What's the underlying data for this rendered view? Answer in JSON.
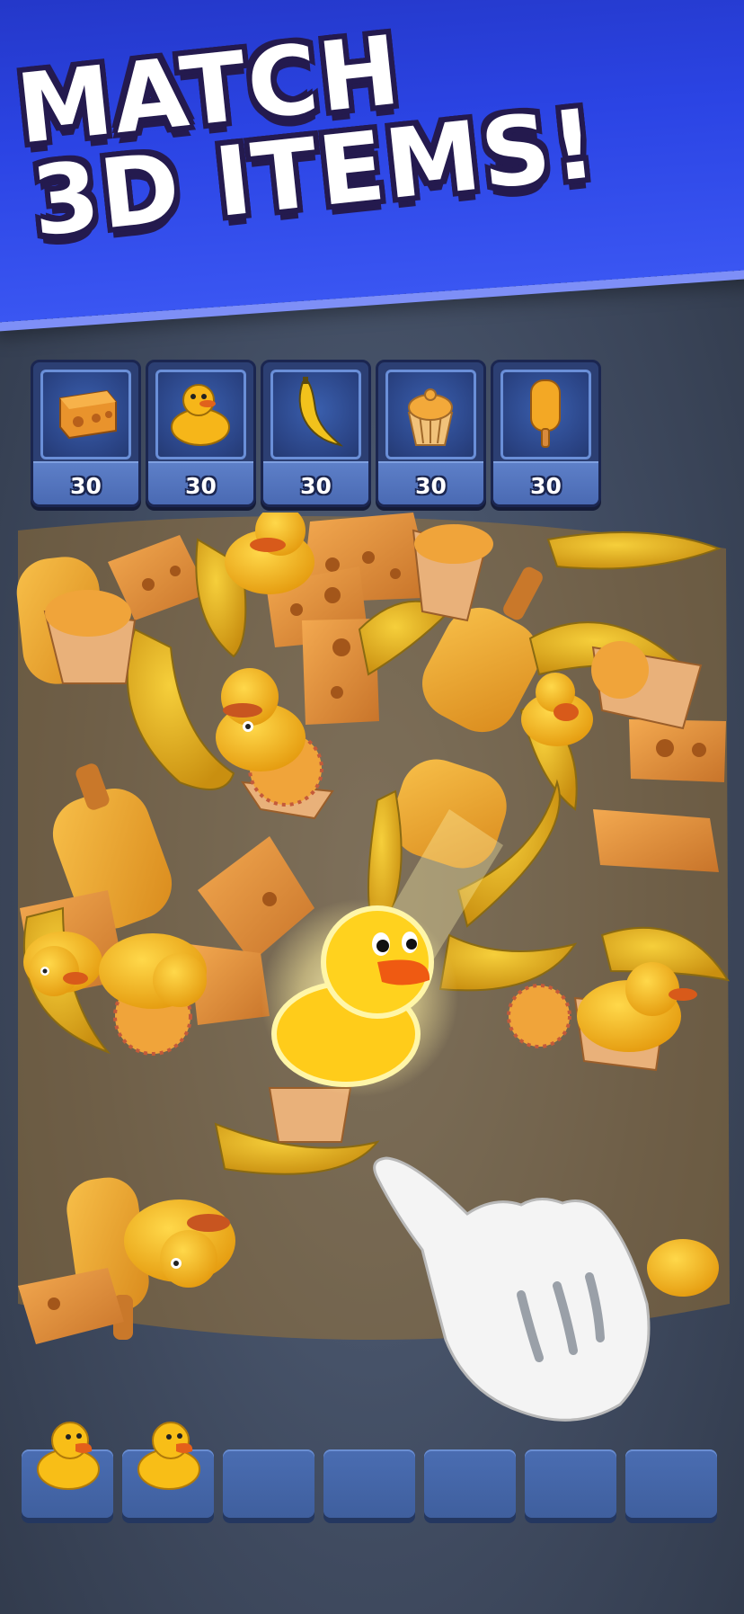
{
  "headline": {
    "line1": "MATCH",
    "line2": "3D ITEMS!"
  },
  "goals": [
    {
      "icon": "cheese-block-icon",
      "count": "30"
    },
    {
      "icon": "rubber-duck-icon",
      "count": "30"
    },
    {
      "icon": "banana-icon",
      "count": "30"
    },
    {
      "icon": "cupcake-icon",
      "count": "30"
    },
    {
      "icon": "popsicle-icon",
      "count": "30"
    }
  ],
  "pile": {
    "highlighted_item": "rubber-duck-icon",
    "hint": "pointing-hand-icon"
  },
  "tray": {
    "slots": 7,
    "filled": [
      "rubber-duck-icon",
      "rubber-duck-icon"
    ]
  },
  "colors": {
    "banner": "#2b44e4",
    "background": "#3f4b60",
    "item_yellow": "#f2b320",
    "item_orange": "#e08a2a",
    "slot": "#4a6db2"
  }
}
